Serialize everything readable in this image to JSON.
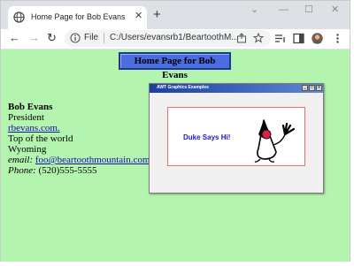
{
  "browser": {
    "tab_title": "Home Page for Bob Evans",
    "tab_close": "✕",
    "new_tab": "+",
    "file_label": "File",
    "url": "C:/Users/evansrb1/BeartoothM...",
    "back": "←",
    "forward": "→",
    "reload": "↻",
    "minimize": "—",
    "restore": "☐",
    "close": "✕",
    "chevron": "⌄"
  },
  "page": {
    "heading": "Home Page for Bob Evans",
    "name": "Bob Evans",
    "title": "President",
    "website": "rbevans.com.",
    "line3": "Top of the world",
    "line4": "Wyoming",
    "email_label": "email:",
    "email": "foo@beartoothmountain.com",
    "phone_label": "Phone:",
    "phone": "(520)555-5555"
  },
  "applet": {
    "title": "AWT Graphics Examples",
    "message": "Duke Says Hi!",
    "min": "_",
    "max": "□",
    "close": "x"
  },
  "colors": {
    "page_bg": "#b3f5ae",
    "heading_bg": "#4a6ee0",
    "link": "#1a0dab",
    "duke_text": "#1b1bc8",
    "panel_border": "#e07070"
  }
}
